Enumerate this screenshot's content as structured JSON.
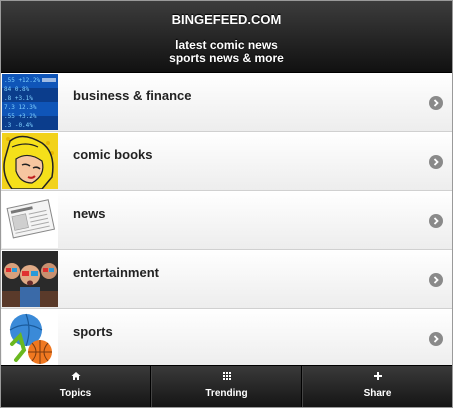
{
  "header": {
    "site_name": "BINGEFEED.COM",
    "tagline_line1": "latest comic news",
    "tagline_line2": "sports news & more"
  },
  "list": {
    "items": [
      {
        "label": "business & finance",
        "thumb": "stock-ticker-image"
      },
      {
        "label": "comic books",
        "thumb": "comic-art-image"
      },
      {
        "label": "news",
        "thumb": "newspaper-image"
      },
      {
        "label": "entertainment",
        "thumb": "3d-cinema-audience-image"
      },
      {
        "label": "sports",
        "thumb": "sports-ball-image"
      }
    ]
  },
  "tabbar": {
    "tabs": [
      {
        "label": "Topics",
        "icon": "home-icon"
      },
      {
        "label": "Trending",
        "icon": "grid-icon"
      },
      {
        "label": "Share",
        "icon": "plus-icon"
      }
    ]
  },
  "colors": {
    "header_bg": "#1a1a1a",
    "chevron": "#8a8a8a",
    "tabbar_bg": "#222222"
  }
}
